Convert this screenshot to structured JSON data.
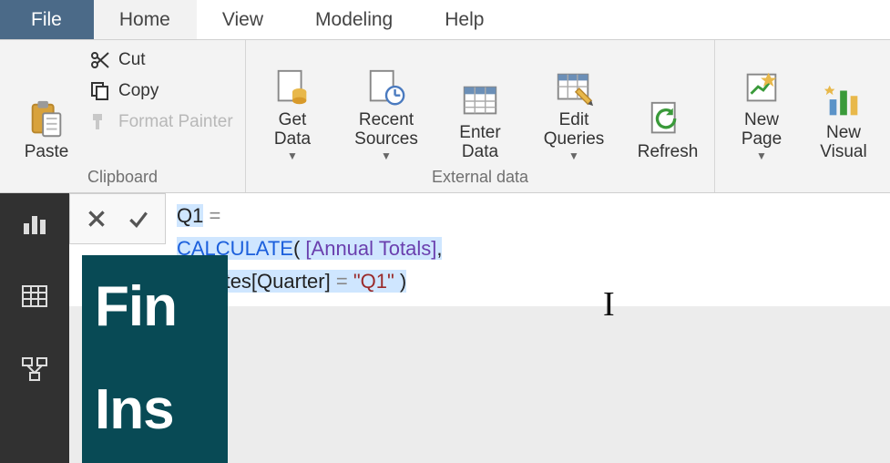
{
  "menu": {
    "file": "File",
    "home": "Home",
    "view": "View",
    "modeling": "Modeling",
    "help": "Help"
  },
  "ribbon": {
    "clipboard": {
      "label": "Clipboard",
      "paste": "Paste",
      "cut": "Cut",
      "copy": "Copy",
      "format_painter": "Format Painter"
    },
    "external_data": {
      "label": "External data",
      "get_data": "Get\nData",
      "recent_sources": "Recent\nSources",
      "enter_data": "Enter\nData",
      "edit_queries": "Edit\nQueries",
      "refresh": "Refresh"
    },
    "insert": {
      "new_page": "New\nPage",
      "new_visual": "New\nVisual"
    }
  },
  "formula": {
    "line1_name": "Q1",
    "line1_eq": " = ",
    "line2_fn": "CALCULATE",
    "line2_open": "( ",
    "line2_ref": "[Annual Totals]",
    "line2_comma": ",",
    "line3_indent": "    ",
    "line3_table": "Dates[Quarter]",
    "line3_eq": " = ",
    "line3_str": "\"Q1\"",
    "line3_close": " )"
  },
  "report": {
    "title1": "Fin",
    "title2": "Ins"
  }
}
